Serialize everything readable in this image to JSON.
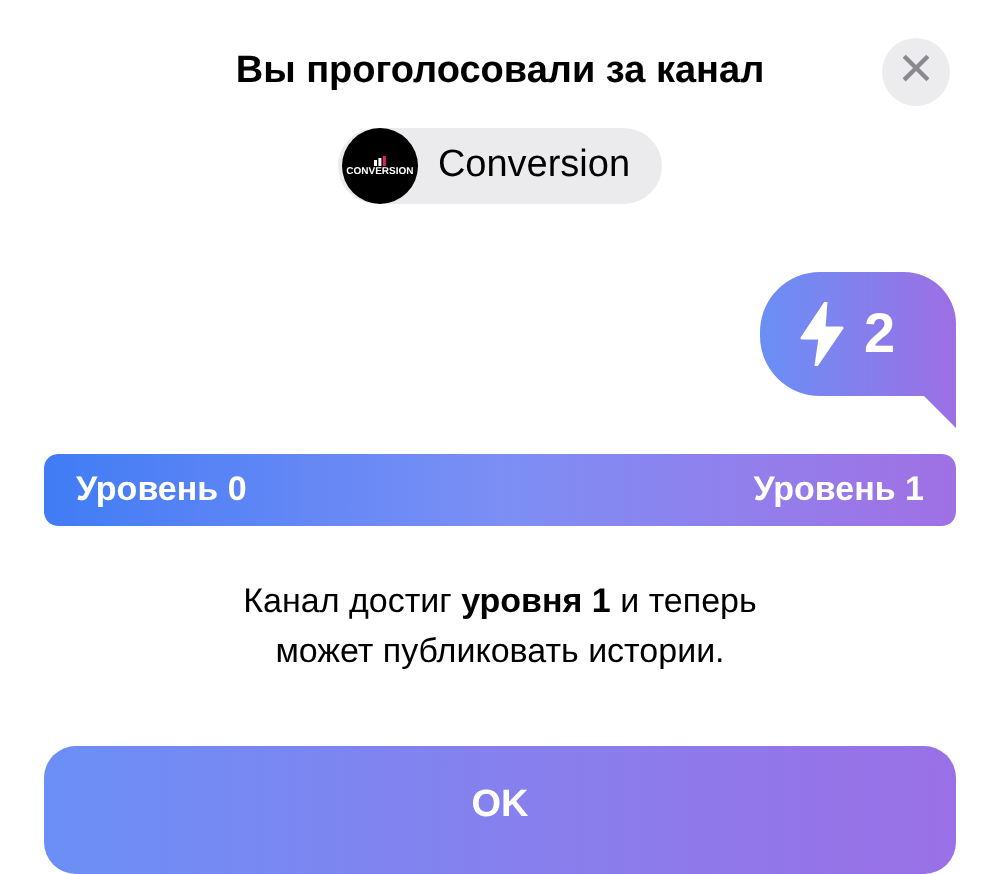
{
  "title": "Вы проголосовали за канал",
  "close_button": {
    "label": "×"
  },
  "channel": {
    "logo_text": "CONVERSION",
    "name": "Conversion"
  },
  "boost_badge": {
    "count": "2"
  },
  "progress": {
    "level": 1,
    "start_label": "Уровень 0",
    "end_label": "Уровень 1"
  },
  "message": "Канал достиг **уровня 1** и теперь может публиковать истории.",
  "ok_button": {
    "label": "OK"
  }
}
